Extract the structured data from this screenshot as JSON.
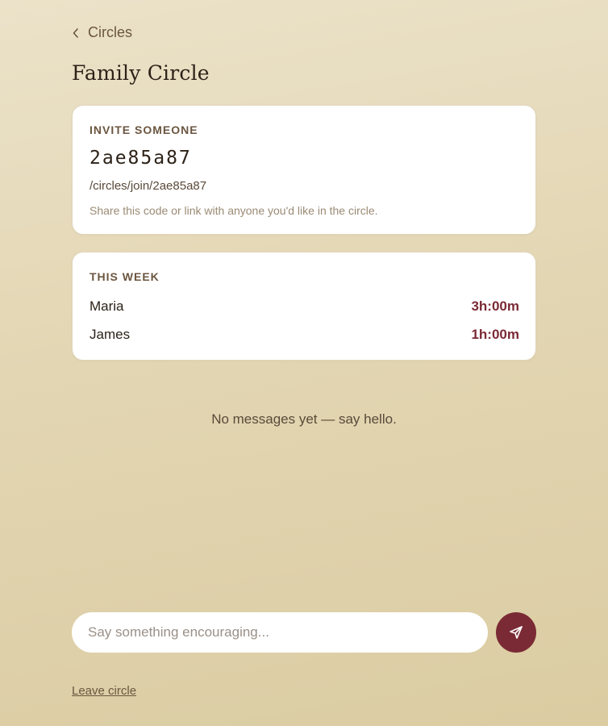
{
  "nav": {
    "back_label": "Circles",
    "back_icon": "chevron-left-icon"
  },
  "page": {
    "title": "Family Circle"
  },
  "invite": {
    "heading": "INVITE SOMEONE",
    "code": "2ae85a87",
    "link": "/circles/join/2ae85a87",
    "help_text": "Share this code or link with anyone you'd like in the circle."
  },
  "week": {
    "heading": "THIS WEEK",
    "members": [
      {
        "name": "Maria",
        "time": "3h:00m"
      },
      {
        "name": "James",
        "time": "1h:00m"
      }
    ]
  },
  "messages": {
    "empty_text": "No messages yet — say hello."
  },
  "composer": {
    "placeholder": "Say something encouraging...",
    "value": "",
    "send_icon": "send-icon"
  },
  "footer": {
    "leave_label": "Leave circle"
  },
  "colors": {
    "accent": "#7a2a35",
    "background": "#e3d6b3",
    "card": "#ffffff"
  }
}
